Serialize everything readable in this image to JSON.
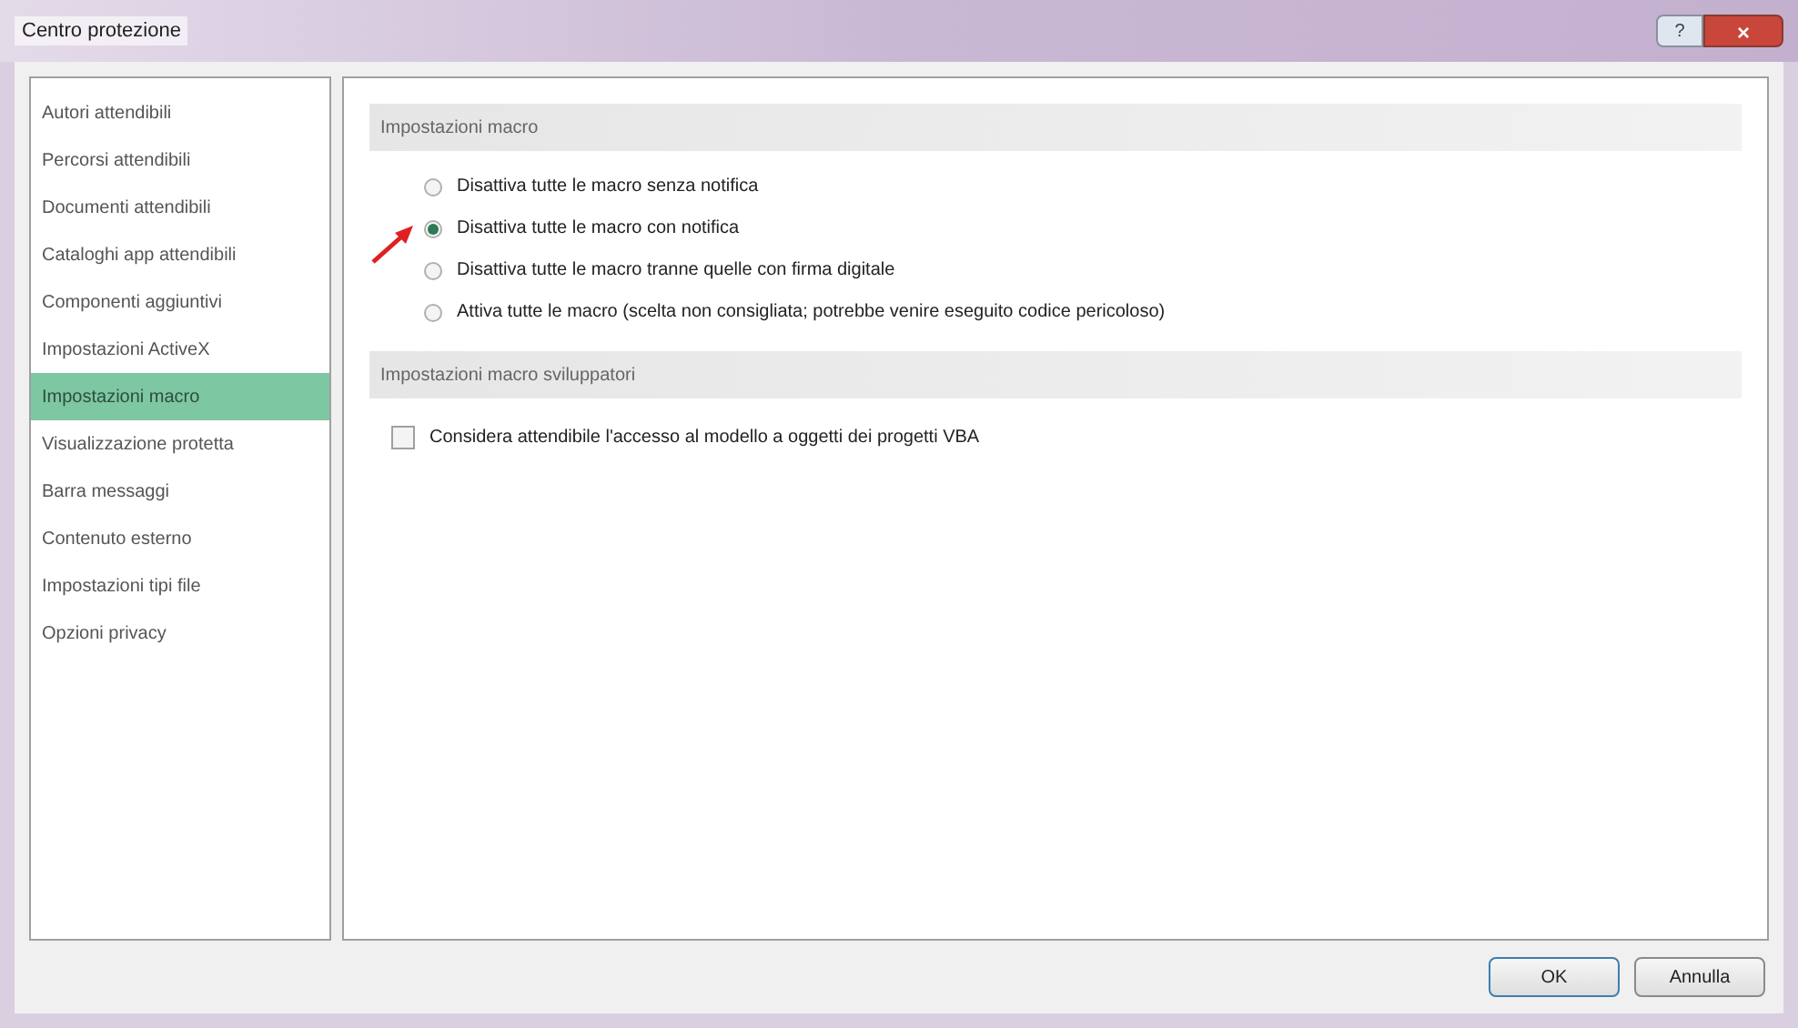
{
  "window": {
    "title": "Centro protezione",
    "title_buttons": [
      "?",
      "×"
    ]
  },
  "sidebar": {
    "items": [
      {
        "label": "Autori attendibili",
        "selected": false
      },
      {
        "label": "Percorsi attendibili",
        "selected": false
      },
      {
        "label": "Documenti attendibili",
        "selected": false
      },
      {
        "label": "Cataloghi app attendibili",
        "selected": false
      },
      {
        "label": "Componenti aggiuntivi",
        "selected": false
      },
      {
        "label": "Impostazioni ActiveX",
        "selected": false
      },
      {
        "label": "Impostazioni macro",
        "selected": true
      },
      {
        "label": "Visualizzazione protetta",
        "selected": false
      },
      {
        "label": "Barra messaggi",
        "selected": false
      },
      {
        "label": "Contenuto esterno",
        "selected": false
      },
      {
        "label": "Impostazioni tipi file",
        "selected": false
      },
      {
        "label": "Opzioni privacy",
        "selected": false
      }
    ]
  },
  "sections": [
    {
      "heading": "Impostazioni macro",
      "options": [
        {
          "kind": "radio",
          "label": "Disattiva tutte le macro senza notifica",
          "selected": false
        },
        {
          "kind": "radio",
          "label": "Disattiva tutte le macro con notifica",
          "selected": true
        },
        {
          "kind": "radio",
          "label": "Disattiva tutte le macro tranne quelle con firma digitale",
          "selected": false
        },
        {
          "kind": "radio",
          "label": "Attiva tutte le macro (scelta non consigliata; potrebbe venire eseguito codice pericoloso)",
          "selected": false
        }
      ]
    },
    {
      "heading": "Impostazioni macro sviluppatori",
      "options": [
        {
          "kind": "checkbox",
          "label": "Considera attendibile l'accesso al modello a oggetti dei progetti VBA",
          "checked": false
        }
      ]
    }
  ],
  "buttons": [
    "OK",
    "Annulla"
  ]
}
